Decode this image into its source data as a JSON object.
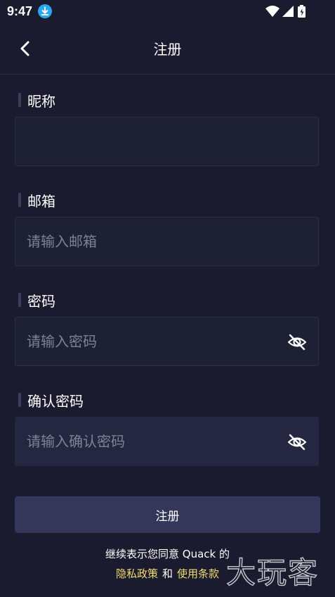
{
  "status_bar": {
    "time": "9:47",
    "icons": [
      "download-icon",
      "wifi-icon",
      "signal-icon",
      "battery-charging-icon"
    ]
  },
  "header": {
    "title": "注册",
    "back_icon": "chevron-left-icon"
  },
  "form": {
    "nickname": {
      "label": "昵称",
      "placeholder": "",
      "value": ""
    },
    "email": {
      "label": "邮箱",
      "placeholder": "请输入邮箱",
      "value": ""
    },
    "password": {
      "label": "密码",
      "placeholder": "请输入密码",
      "value": "",
      "toggle_icon": "eye-off-icon"
    },
    "confirm_password": {
      "label": "确认密码",
      "placeholder": "请输入确认密码",
      "value": "",
      "toggle_icon": "eye-off-icon"
    }
  },
  "submit": {
    "label": "注册"
  },
  "terms": {
    "prefix": "继续表示您同意 Quack 的",
    "privacy_link": "隐私政策",
    "and": "和",
    "terms_link": "使用条款"
  },
  "watermark": {
    "text": "大玩客"
  },
  "colors": {
    "background": "#1a1b2e",
    "field_background": "#1e2033",
    "button_background": "#34365a",
    "link": "#f2dd6a",
    "placeholder": "#7f8194"
  }
}
